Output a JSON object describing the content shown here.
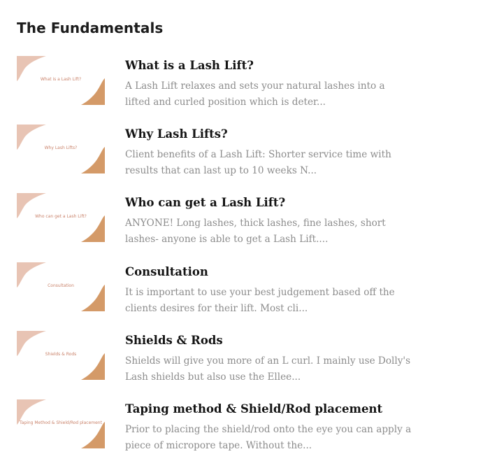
{
  "section": {
    "title": "The Fundamentals"
  },
  "colors": {
    "thumb_blob_light": "#e8c4b4",
    "thumb_blob_dark": "#d49a68",
    "thumb_caption": "#c9826a",
    "excerpt_text": "#8c8c8c"
  },
  "lessons": [
    {
      "thumb_caption": "What is a Lash Lift?",
      "title": "What is a Lash Lift?",
      "excerpt": "A Lash Lift relaxes and sets your natural lashes into a lifted and curled position which is deter..."
    },
    {
      "thumb_caption": "Why Lash Lifts?",
      "title": "Why Lash Lifts?",
      "excerpt": "Client benefits of a Lash Lift: Shorter service time with results that can last up to 10 weeks N..."
    },
    {
      "thumb_caption": "Who can get a Lash Lift?",
      "title": "Who can get a Lash Lift?",
      "excerpt": "ANYONE! Long lashes, thick lashes, fine lashes, short lashes- anyone is able to get a Lash Lift...."
    },
    {
      "thumb_caption": "Consultation",
      "title": "Consultation",
      "excerpt": "It is important to use your best judgement based off the clients desires for their lift. Most cli..."
    },
    {
      "thumb_caption": "Shields & Rods",
      "title": "Shields & Rods",
      "excerpt": "Shields will give you more of an L curl. I mainly use Dolly's Lash shields but also use the Ellee..."
    },
    {
      "thumb_caption": "Taping Method & Shield/Rod placement",
      "title": "Taping method & Shield/Rod placement",
      "excerpt": "Prior to placing the shield/rod onto the eye you can apply a piece of micropore tape. Without the..."
    }
  ]
}
